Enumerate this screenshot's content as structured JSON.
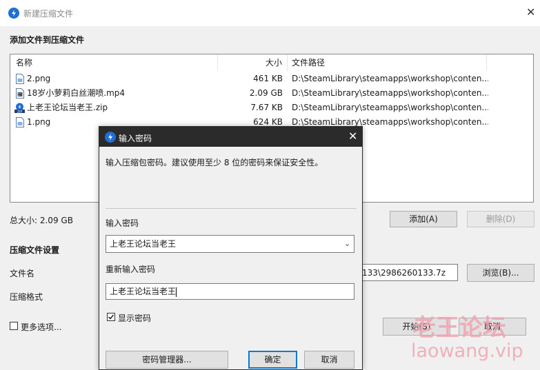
{
  "main_window": {
    "title": "新建压缩文件",
    "add_section_title": "添加文件到压缩文件",
    "columns": {
      "name": "名称",
      "size": "大小",
      "path": "文件路径"
    },
    "files": [
      {
        "name": "2.png",
        "size": "461 KB",
        "path": "D:\\SteamLibrary\\steamapps\\workshop\\conten...",
        "icon": "image-file-icon"
      },
      {
        "name": "18岁小萝莉白丝潮喷.mp4",
        "size": "2.09 GB",
        "path": "D:\\SteamLibrary\\steamapps\\workshop\\conten...",
        "icon": "video-file-icon"
      },
      {
        "name": "上老王论坛当老王.zip",
        "size": "7.67 KB",
        "path": "D:\\SteamLibrary\\steamapps\\workshop\\conten...",
        "icon": "zip-file-icon"
      },
      {
        "name": "1.png",
        "size": "624 KB",
        "path": "D:\\SteamLibrary\\steamapps\\workshop\\conten...",
        "icon": "image-file-icon"
      }
    ],
    "total_size": "总大小: 2.09 GB",
    "add_button": "添加(A)",
    "delete_button": "删除(D)",
    "settings_title": "压缩文件设置",
    "filename_label": "文件名",
    "filename_value": "133\\2986260133.7z",
    "browse_button": "浏览(B)...",
    "format_label": "压缩格式",
    "more_options": "更多选项...",
    "start_button": "开始(S)",
    "cancel_button": "取消"
  },
  "dialog": {
    "title": "输入密码",
    "description": "输入压缩包密码。建议使用至少 8 位的密码来保证安全性。",
    "password_label": "输入密码",
    "password_value": "上老王论坛当老王",
    "confirm_label": "重新输入密码",
    "confirm_value": "上老王论坛当老王",
    "show_password": "显示密码",
    "show_password_checked": true,
    "manager_button": "密码管理器...",
    "ok_button": "确定",
    "cancel_button": "取消"
  },
  "watermark": {
    "line1": "老王论坛",
    "line2": "laowang.vip"
  },
  "colors": {
    "accent": "#0078d7",
    "dialog_title_bg": "#2b2b2b",
    "app_logo": "#1f6ed4",
    "watermark": "#f2a0b0"
  }
}
